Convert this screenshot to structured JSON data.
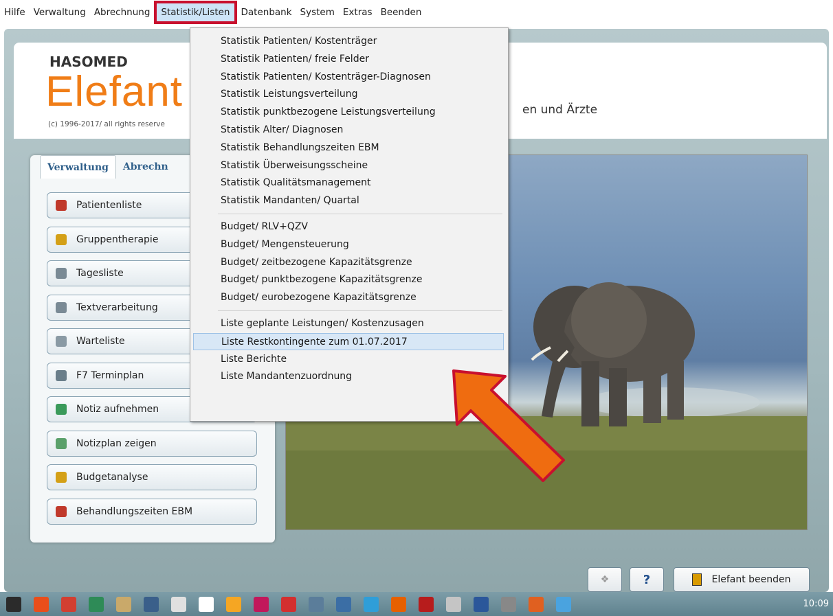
{
  "menubar": {
    "items": [
      "Hilfe",
      "Verwaltung",
      "Abrechnung",
      "Statistik/Listen",
      "Datenbank",
      "System",
      "Extras",
      "Beenden"
    ]
  },
  "header": {
    "brand_small": "HASOMED",
    "brand_big": "Elefant",
    "copyright": "(c) 1996-2017/ all rights reserve",
    "tagline": "en und Ärzte"
  },
  "tabs": [
    "Verwaltung",
    "Abrechn"
  ],
  "buttons": [
    {
      "label": "Patientenliste",
      "icon": "patient-icon",
      "color": "#c0392b"
    },
    {
      "label": "Gruppentherapie",
      "icon": "group-icon",
      "color": "#d4a017"
    },
    {
      "label": "Tagesliste",
      "icon": "list-icon",
      "color": "#7a8a95"
    },
    {
      "label": "Textverarbeitung",
      "icon": "printer-icon",
      "color": "#7a8a95"
    },
    {
      "label": "Warteliste",
      "icon": "clipboard-icon",
      "color": "#8a9aa4"
    },
    {
      "label": "F7 Terminplan",
      "icon": "calendar-icon",
      "color": "#6a7e8a"
    },
    {
      "label": "Notiz aufnehmen",
      "icon": "note-icon",
      "color": "#3a9a5a"
    },
    {
      "label": "Notizplan zeigen",
      "icon": "note-plan-icon",
      "color": "#5aa06a"
    },
    {
      "label": "Budgetanalyse",
      "icon": "budget-icon",
      "color": "#d4a017"
    },
    {
      "label": "Behandlungszeiten  EBM",
      "icon": "clock-icon",
      "color": "#c0392b"
    }
  ],
  "dropdown": {
    "group1": [
      "Statistik Patienten/ Kostenträger",
      "Statistik Patienten/ freie Felder",
      "Statistik Patienten/ Kostenträger-Diagnosen",
      "Statistik Leistungsverteilung",
      "Statistik punktbezogene Leistungsverteilung",
      "Statistik Alter/ Diagnosen",
      "Statistik Behandlungszeiten EBM",
      "Statistik Überweisungsscheine",
      "Statistik Qualitätsmanagement",
      "Statistik Mandanten/ Quartal"
    ],
    "group2": [
      "Budget/ RLV+QZV",
      "Budget/ Mengensteuerung",
      "Budget/ zeitbezogene Kapazitätsgrenze",
      "Budget/ punktbezogene Kapazitätsgrenze",
      "Budget/ eurobezogene Kapazitätsgrenze"
    ],
    "group3": [
      "Liste geplante Leistungen/ Kostenzusagen",
      "Liste Restkontingente zum 01.07.2017",
      "Liste Berichte",
      "Liste Mandantenzuordnung"
    ]
  },
  "bottom": {
    "help_label": "?",
    "exit_label": "Elefant beenden"
  },
  "taskbar": {
    "clock": "10:09",
    "colors": [
      "#2b2b2b",
      "#e94e1b",
      "#d23f31",
      "#2e8b57",
      "#c9a96a",
      "#3a5f8a",
      "#e0e0e0",
      "#ffffff",
      "#f5a623",
      "#c2185b",
      "#d32f2f",
      "#5b7d9a",
      "#3b6ea5",
      "#2f9ed8",
      "#e66000",
      "#b71c1c",
      "#c5c5c5",
      "#2b579a",
      "#888888",
      "#e06020",
      "#4aa3df"
    ]
  }
}
